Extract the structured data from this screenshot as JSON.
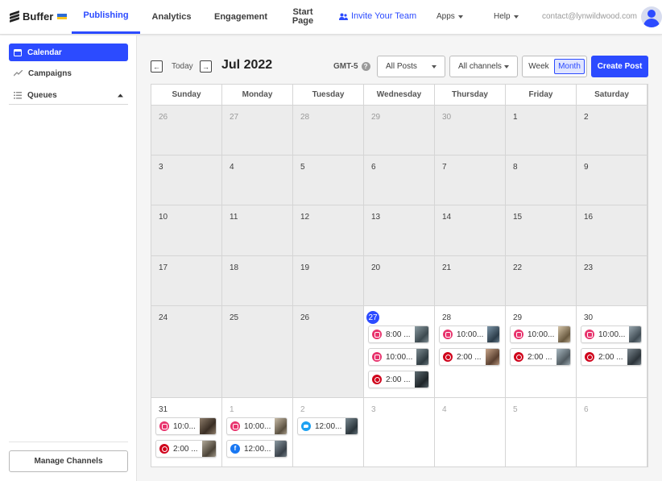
{
  "app": {
    "logo_text": "Buffer",
    "tabs": [
      {
        "label": "Publishing",
        "active": true
      },
      {
        "label": "Analytics",
        "active": false
      },
      {
        "label": "Engagement",
        "active": false
      },
      {
        "label": "Start\nPage",
        "active": false
      }
    ],
    "invite_label": "Invite Your Team",
    "apps_label": "Apps",
    "help_label": "Help",
    "email": "contact@lynwildwood.com",
    "accent": "#2c4bff"
  },
  "sidebar": {
    "items": [
      {
        "label": "Calendar",
        "icon": "calendar-icon",
        "active": true
      },
      {
        "label": "Campaigns",
        "icon": "trend-icon",
        "active": false
      },
      {
        "label": "Queues",
        "icon": "list-icon",
        "active": false
      }
    ],
    "manage_label": "Manage Channels"
  },
  "toolbar": {
    "today_label": "Today",
    "month_title": "Jul 2022",
    "timezone": "GMT-5",
    "posts_filter": "All Posts",
    "channels_filter": "All channels",
    "week_label": "Week",
    "month_label": "Month",
    "view_active": "Month",
    "create_label": "Create Post"
  },
  "calendar": {
    "weekdays": [
      "Sunday",
      "Monday",
      "Tuesday",
      "Wednesday",
      "Thursday",
      "Friday",
      "Saturday"
    ],
    "today": "27",
    "weeks": [
      [
        {
          "d": "26",
          "past": true,
          "other": true
        },
        {
          "d": "27",
          "past": true,
          "other": true
        },
        {
          "d": "28",
          "past": true,
          "other": true
        },
        {
          "d": "29",
          "past": true,
          "other": true
        },
        {
          "d": "30",
          "past": true,
          "other": true
        },
        {
          "d": "1",
          "past": true
        },
        {
          "d": "2",
          "past": true
        }
      ],
      [
        {
          "d": "3",
          "past": true
        },
        {
          "d": "4",
          "past": true
        },
        {
          "d": "5",
          "past": true
        },
        {
          "d": "6",
          "past": true
        },
        {
          "d": "7",
          "past": true
        },
        {
          "d": "8",
          "past": true
        },
        {
          "d": "9",
          "past": true
        }
      ],
      [
        {
          "d": "10",
          "past": true
        },
        {
          "d": "11",
          "past": true
        },
        {
          "d": "12",
          "past": true
        },
        {
          "d": "13",
          "past": true
        },
        {
          "d": "14",
          "past": true
        },
        {
          "d": "15",
          "past": true
        },
        {
          "d": "16",
          "past": true
        }
      ],
      [
        {
          "d": "17",
          "past": true
        },
        {
          "d": "18",
          "past": true
        },
        {
          "d": "19",
          "past": true
        },
        {
          "d": "20",
          "past": true
        },
        {
          "d": "21",
          "past": true
        },
        {
          "d": "22",
          "past": true
        },
        {
          "d": "23",
          "past": true
        }
      ],
      [
        {
          "d": "24",
          "past": true
        },
        {
          "d": "25",
          "past": true
        },
        {
          "d": "26",
          "past": true
        },
        {
          "d": "27",
          "today": true,
          "posts": [
            {
              "net": "instagram",
              "time": "8:00 ...",
              "thumb": [
                "#8a9aa0",
                "#3d4a50"
              ]
            },
            {
              "net": "instagram",
              "time": "10:00...",
              "thumb": [
                "#7d8c92",
                "#2e3a40"
              ]
            },
            {
              "net": "pinterest",
              "time": "2:00 ...",
              "thumb": [
                "#5c6a70",
                "#1e2428"
              ]
            }
          ]
        },
        {
          "d": "28",
          "posts": [
            {
              "net": "instagram",
              "time": "10:00...",
              "thumb": [
                "#7c95a8",
                "#2c3d4a"
              ]
            },
            {
              "net": "pinterest",
              "time": "2:00 ...",
              "thumb": [
                "#c8a58a",
                "#5a4030"
              ]
            }
          ]
        },
        {
          "d": "29",
          "posts": [
            {
              "net": "instagram",
              "time": "10:00...",
              "thumb": [
                "#d4c4a8",
                "#6a5a40"
              ]
            },
            {
              "net": "pinterest",
              "time": "2:00 ...",
              "thumb": [
                "#a8b8c0",
                "#505a60"
              ]
            }
          ]
        },
        {
          "d": "30",
          "posts": [
            {
              "net": "instagram",
              "time": "10:00...",
              "thumb": [
                "#9aa8b0",
                "#404c54"
              ]
            },
            {
              "net": "pinterest",
              "time": "2:00 ...",
              "thumb": [
                "#7c8890",
                "#2c343a"
              ]
            }
          ]
        }
      ],
      [
        {
          "d": "31",
          "posts": [
            {
              "net": "instagram",
              "time": "10:0...",
              "thumb": [
                "#8c7c6a",
                "#3a2e24"
              ]
            },
            {
              "net": "pinterest",
              "time": "2:00 ...",
              "thumb": [
                "#b0a898",
                "#4c4438"
              ]
            }
          ]
        },
        {
          "d": "1",
          "other": true,
          "posts": [
            {
              "net": "instagram",
              "time": "10:00...",
              "thumb": [
                "#c8bca8",
                "#5a5040"
              ]
            },
            {
              "net": "facebook",
              "time": "12:00...",
              "thumb": [
                "#8a98a0",
                "#384048"
              ]
            }
          ]
        },
        {
          "d": "2",
          "other": true,
          "posts": [
            {
              "net": "twitter",
              "time": "12:00...",
              "thumb": [
                "#7a8a92",
                "#2a343a"
              ]
            }
          ]
        },
        {
          "d": "3",
          "other": true
        },
        {
          "d": "4",
          "other": true
        },
        {
          "d": "5",
          "other": true
        },
        {
          "d": "6",
          "other": true
        }
      ]
    ]
  }
}
